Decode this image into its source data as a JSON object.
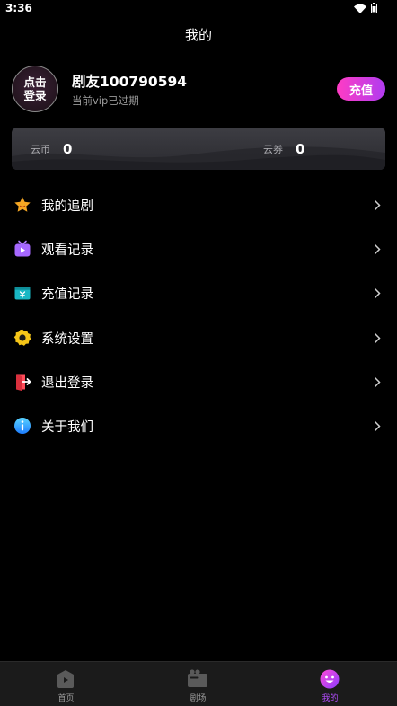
{
  "status_bar": {
    "time": "3:36"
  },
  "header": {
    "title": "我的"
  },
  "profile": {
    "avatar_line1": "点击",
    "avatar_line2": "登录",
    "username": "剧友100790594",
    "vip_status": "当前vip已过期",
    "recharge_label": "充值"
  },
  "balance": {
    "coin_label": "云币",
    "coin_value": "0",
    "coupon_label": "云券",
    "coupon_value": "0"
  },
  "menu": {
    "items": [
      {
        "label": "我的追剧",
        "icon": "star-icon"
      },
      {
        "label": "观看记录",
        "icon": "tv-play-icon"
      },
      {
        "label": "充值记录",
        "icon": "wallet-icon"
      },
      {
        "label": "系统设置",
        "icon": "gear-icon"
      },
      {
        "label": "退出登录",
        "icon": "logout-icon"
      },
      {
        "label": "关于我们",
        "icon": "info-icon"
      }
    ]
  },
  "bottom_nav": {
    "items": [
      {
        "label": "首页",
        "icon": "home-play-icon",
        "active": false
      },
      {
        "label": "剧场",
        "icon": "theater-icon",
        "active": false
      },
      {
        "label": "我的",
        "icon": "smiley-icon",
        "active": true
      }
    ]
  },
  "colors": {
    "accent": "#b44dff",
    "recharge_gradient_start": "#ff3cc4",
    "recharge_gradient_end": "#b03cf0",
    "background": "#000000"
  }
}
